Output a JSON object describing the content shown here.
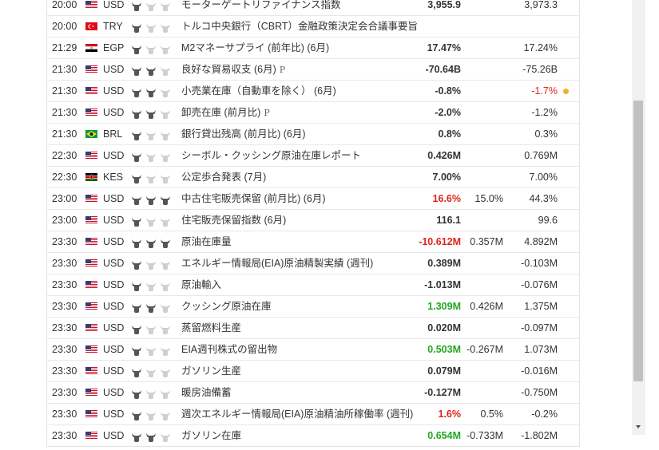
{
  "colors": {
    "positive": "#22a722",
    "negative": "#e2231a",
    "revision_dot": "#f0b030",
    "bull_dark": "#555555",
    "bull_light": "#cfcfcf"
  },
  "rows": [
    {
      "time": "20:00",
      "flag": "us",
      "currency": "USD",
      "importance": 1,
      "event": "モーターゲートリファイナンス指数",
      "preliminary": "",
      "actual": "3,955.9",
      "actual_color": "",
      "forecast": "",
      "previous": "3,973.3",
      "previous_color": "",
      "revised": false
    },
    {
      "time": "20:00",
      "flag": "tr",
      "currency": "TRY",
      "importance": 1,
      "event": "トルコ中央銀行（CBRT）金融政策決定会合議事要旨",
      "preliminary": "",
      "actual": "",
      "actual_color": "",
      "forecast": "",
      "previous": "",
      "previous_color": "",
      "revised": false
    },
    {
      "time": "21:29",
      "flag": "eg",
      "currency": "EGP",
      "importance": 1,
      "event": "M2マネーサプライ (前年比) (6月)",
      "preliminary": "",
      "actual": "17.47%",
      "actual_color": "",
      "forecast": "",
      "previous": "17.24%",
      "previous_color": "",
      "revised": false
    },
    {
      "time": "21:30",
      "flag": "us",
      "currency": "USD",
      "importance": 2,
      "event": "良好な貿易収支 (6月)",
      "preliminary": "P",
      "actual": "-70.64B",
      "actual_color": "",
      "forecast": "",
      "previous": "-75.26B",
      "previous_color": "",
      "revised": false
    },
    {
      "time": "21:30",
      "flag": "us",
      "currency": "USD",
      "importance": 2,
      "event": "小売業在庫（自動車を除く） (6月)",
      "preliminary": "",
      "actual": "-0.8%",
      "actual_color": "",
      "forecast": "",
      "previous": "-1.7%",
      "previous_color": "neg",
      "revised": true
    },
    {
      "time": "21:30",
      "flag": "us",
      "currency": "USD",
      "importance": 2,
      "event": "卸売在庫 (前月比)",
      "preliminary": "P",
      "actual": "-2.0%",
      "actual_color": "",
      "forecast": "",
      "previous": "-1.2%",
      "previous_color": "",
      "revised": false
    },
    {
      "time": "21:30",
      "flag": "br",
      "currency": "BRL",
      "importance": 1,
      "event": "銀行貸出残高 (前月比) (6月)",
      "preliminary": "",
      "actual": "0.8%",
      "actual_color": "",
      "forecast": "",
      "previous": "0.3%",
      "previous_color": "",
      "revised": false
    },
    {
      "time": "22:30",
      "flag": "us",
      "currency": "USD",
      "importance": 1,
      "event": "シーボル・クッシング原油在庫レポート",
      "preliminary": "",
      "actual": "0.426M",
      "actual_color": "",
      "forecast": "",
      "previous": "0.769M",
      "previous_color": "",
      "revised": false
    },
    {
      "time": "22:30",
      "flag": "ke",
      "currency": "KES",
      "importance": 1,
      "event": "公定歩合発表 (7月)",
      "preliminary": "",
      "actual": "7.00%",
      "actual_color": "",
      "forecast": "",
      "previous": "7.00%",
      "previous_color": "",
      "revised": false
    },
    {
      "time": "23:00",
      "flag": "us",
      "currency": "USD",
      "importance": 3,
      "event": "中古住宅販売保留 (前月比) (6月)",
      "preliminary": "",
      "actual": "16.6%",
      "actual_color": "neg",
      "forecast": "15.0%",
      "previous": "44.3%",
      "previous_color": "",
      "revised": false
    },
    {
      "time": "23:00",
      "flag": "us",
      "currency": "USD",
      "importance": 1,
      "event": "住宅販売保留指数 (6月)",
      "preliminary": "",
      "actual": "116.1",
      "actual_color": "",
      "forecast": "",
      "previous": "99.6",
      "previous_color": "",
      "revised": false
    },
    {
      "time": "23:30",
      "flag": "us",
      "currency": "USD",
      "importance": 3,
      "event": "原油在庫量",
      "preliminary": "",
      "actual": "-10.612M",
      "actual_color": "neg",
      "forecast": "0.357M",
      "previous": "4.892M",
      "previous_color": "",
      "revised": false
    },
    {
      "time": "23:30",
      "flag": "us",
      "currency": "USD",
      "importance": 1,
      "event": "エネルギー情報局(EIA)原油精製実績 (週刊)",
      "preliminary": "",
      "actual": "0.389M",
      "actual_color": "",
      "forecast": "",
      "previous": "-0.103M",
      "previous_color": "",
      "revised": false
    },
    {
      "time": "23:30",
      "flag": "us",
      "currency": "USD",
      "importance": 1,
      "event": "原油輸入",
      "preliminary": "",
      "actual": "-1.013M",
      "actual_color": "",
      "forecast": "",
      "previous": "-0.076M",
      "previous_color": "",
      "revised": false
    },
    {
      "time": "23:30",
      "flag": "us",
      "currency": "USD",
      "importance": 2,
      "event": "クッシング原油在庫",
      "preliminary": "",
      "actual": "1.309M",
      "actual_color": "pos",
      "forecast": "0.426M",
      "previous": "1.375M",
      "previous_color": "",
      "revised": false
    },
    {
      "time": "23:30",
      "flag": "us",
      "currency": "USD",
      "importance": 1,
      "event": "蒸留燃料生産",
      "preliminary": "",
      "actual": "0.020M",
      "actual_color": "",
      "forecast": "",
      "previous": "-0.097M",
      "previous_color": "",
      "revised": false
    },
    {
      "time": "23:30",
      "flag": "us",
      "currency": "USD",
      "importance": 1,
      "event": "EIA週刊株式の留出物",
      "preliminary": "",
      "actual": "0.503M",
      "actual_color": "pos",
      "forecast": "-0.267M",
      "previous": "1.073M",
      "previous_color": "",
      "revised": false
    },
    {
      "time": "23:30",
      "flag": "us",
      "currency": "USD",
      "importance": 1,
      "event": "ガソリン生産",
      "preliminary": "",
      "actual": "0.079M",
      "actual_color": "",
      "forecast": "",
      "previous": "-0.016M",
      "previous_color": "",
      "revised": false
    },
    {
      "time": "23:30",
      "flag": "us",
      "currency": "USD",
      "importance": 1,
      "event": "暖房油備蓄",
      "preliminary": "",
      "actual": "-0.127M",
      "actual_color": "",
      "forecast": "",
      "previous": "-0.750M",
      "previous_color": "",
      "revised": false
    },
    {
      "time": "23:30",
      "flag": "us",
      "currency": "USD",
      "importance": 1,
      "event": "週次エネルギー情報局(EIA)原油精油所稼働率 (週刊)",
      "preliminary": "",
      "actual": "1.6%",
      "actual_color": "neg",
      "forecast": "0.5%",
      "previous": "-0.2%",
      "previous_color": "",
      "revised": false
    },
    {
      "time": "23:30",
      "flag": "us",
      "currency": "USD",
      "importance": 2,
      "event": "ガソリン在庫",
      "preliminary": "",
      "actual": "0.654M",
      "actual_color": "pos",
      "forecast": "-0.733M",
      "previous": "-1.802M",
      "previous_color": "",
      "revised": false
    }
  ]
}
